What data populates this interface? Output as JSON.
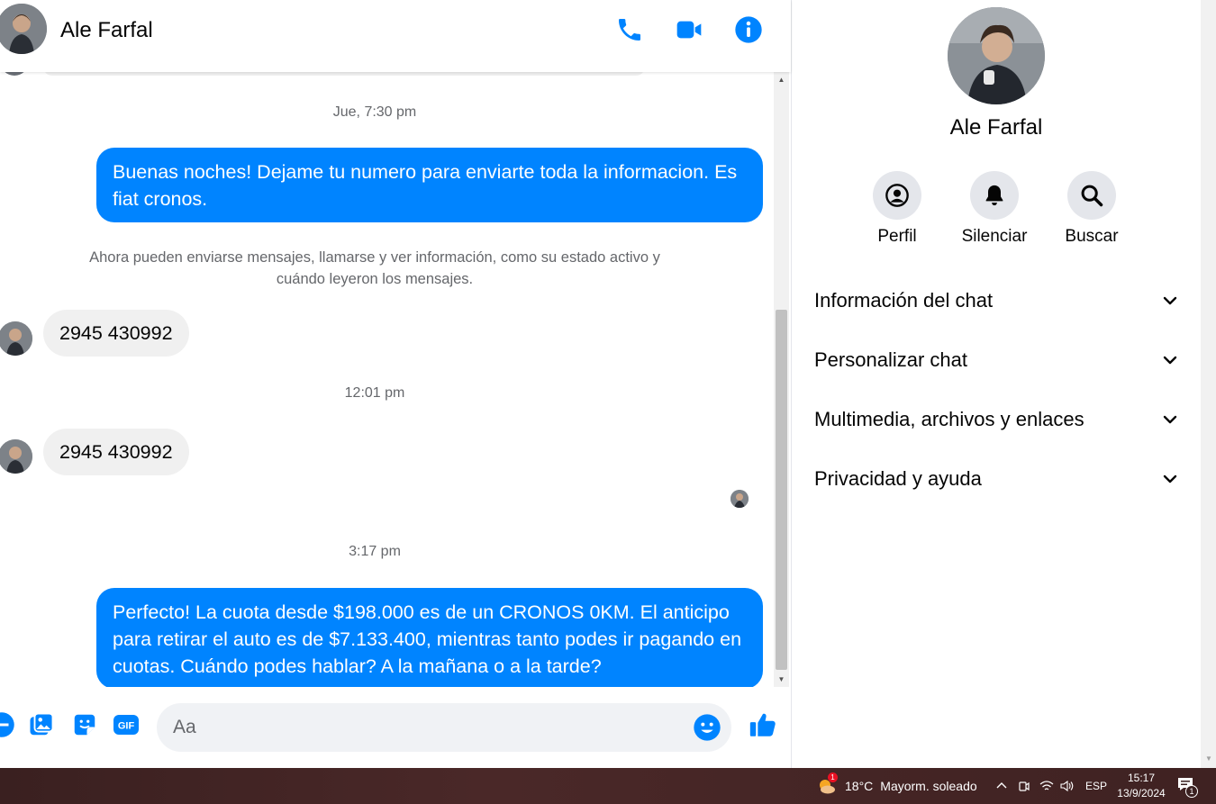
{
  "contact": {
    "name": "Ale Farfal"
  },
  "header": {
    "call_icon": "phone-icon",
    "video_icon": "video-camera-icon",
    "info_icon": "info-icon"
  },
  "messages": {
    "ts1": "Jue, 7:30 pm",
    "out1": "Buenas noches! Dejame tu numero para enviarte toda la informacion. Es fiat cronos.",
    "system": "Ahora pueden enviarse mensajes, llamarse y ver información, como su estado activo y cuándo leyeron los mensajes.",
    "in1": "2945 430992",
    "ts2": "12:01 pm",
    "in2": "2945 430992",
    "ts3": "3:17 pm",
    "out2": "Perfecto! La cuota desde $198.000 es de un CRONOS 0KM. El anticipo para retirar el auto es de $7.133.400, mientras tanto podes ir pagando en cuotas. Cuándo podes hablar? A la mañana o a la tarde?"
  },
  "composer": {
    "placeholder": "Aa",
    "icons": [
      "plus-icon",
      "image-icon",
      "sticker-icon",
      "gif-icon",
      "emoji-icon",
      "thumbs-up-icon"
    ],
    "gif_label": "GIF"
  },
  "panel": {
    "actions": [
      {
        "label": "Perfil",
        "icon": "profile-icon"
      },
      {
        "label": "Silenciar",
        "icon": "bell-icon"
      },
      {
        "label": "Buscar",
        "icon": "search-icon"
      }
    ],
    "sections": [
      "Información del chat",
      "Personalizar chat",
      "Multimedia, archivos y enlaces",
      "Privacidad y ayuda"
    ]
  },
  "taskbar": {
    "weather_temp": "18°C",
    "weather_desc": "Mayorm. soleado",
    "weather_badge": "1",
    "language": "ESP",
    "time": "15:17",
    "date": "13/9/2024",
    "notifications": "1"
  },
  "colors": {
    "accent": "#0084ff",
    "bubble_in": "#f0f0f0",
    "muted_text": "#65676b"
  }
}
